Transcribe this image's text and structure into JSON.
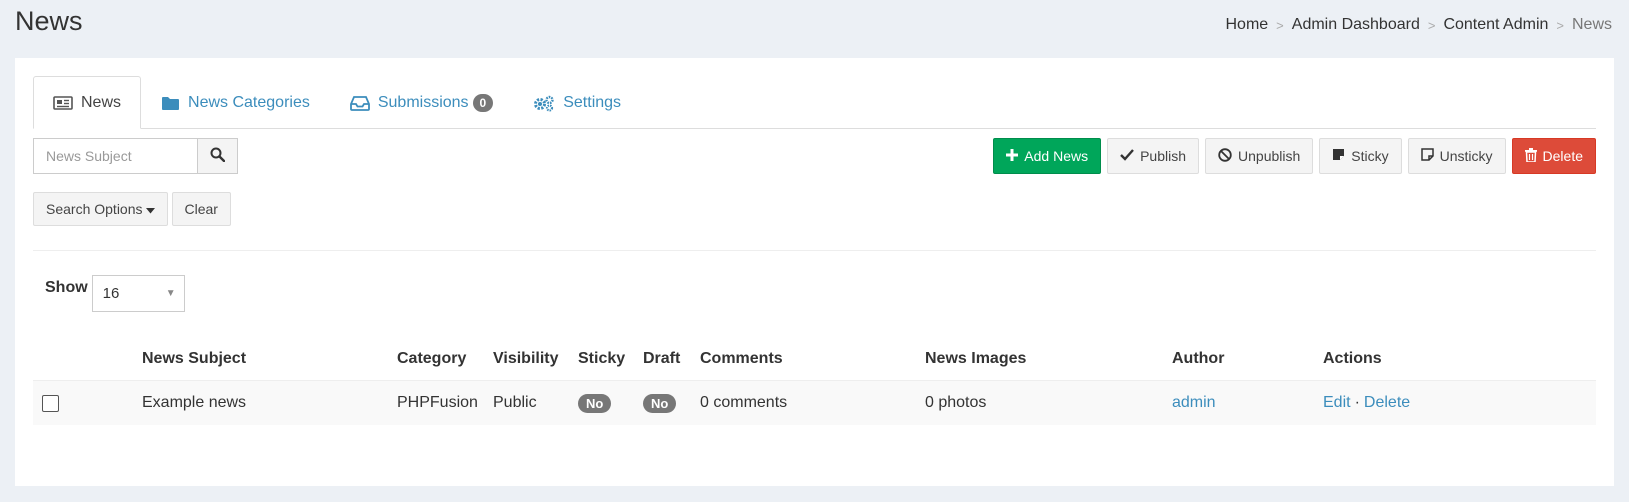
{
  "page": {
    "title": "News"
  },
  "breadcrumb": {
    "items": [
      "Home",
      "Admin Dashboard",
      "Content Admin",
      "News"
    ],
    "separator": ">"
  },
  "tabs": [
    {
      "label": "News",
      "icon": "newspaper-icon",
      "active": true
    },
    {
      "label": "News Categories",
      "icon": "folder-icon"
    },
    {
      "label": "Submissions",
      "icon": "inbox-icon",
      "badge": "0"
    },
    {
      "label": "Settings",
      "icon": "gears-icon"
    }
  ],
  "search": {
    "placeholder": "News Subject",
    "value": ""
  },
  "toolbar": {
    "add_label": "Add News",
    "publish_label": "Publish",
    "unpublish_label": "Unpublish",
    "sticky_label": "Sticky",
    "unsticky_label": "Unsticky",
    "delete_label": "Delete"
  },
  "options": {
    "search_options_label": "Search Options",
    "clear_label": "Clear"
  },
  "pagination": {
    "show_label": "Show",
    "per_page": "16"
  },
  "table": {
    "headers": [
      "News Subject",
      "Category",
      "Visibility",
      "Sticky",
      "Draft",
      "Comments",
      "News Images",
      "Author",
      "Actions"
    ],
    "rows": [
      {
        "subject": "Example news",
        "category": "PHPFusion",
        "visibility": "Public",
        "sticky": "No",
        "draft": "No",
        "comments": "0 comments",
        "images": "0 photos",
        "author": "admin",
        "edit": "Edit",
        "separator": "·",
        "delete": "Delete"
      }
    ]
  },
  "colors": {
    "background": "#ecf0f5",
    "link": "#3c8dbc",
    "success": "#00a65a",
    "danger": "#dd4b39",
    "badge": "#777777"
  }
}
